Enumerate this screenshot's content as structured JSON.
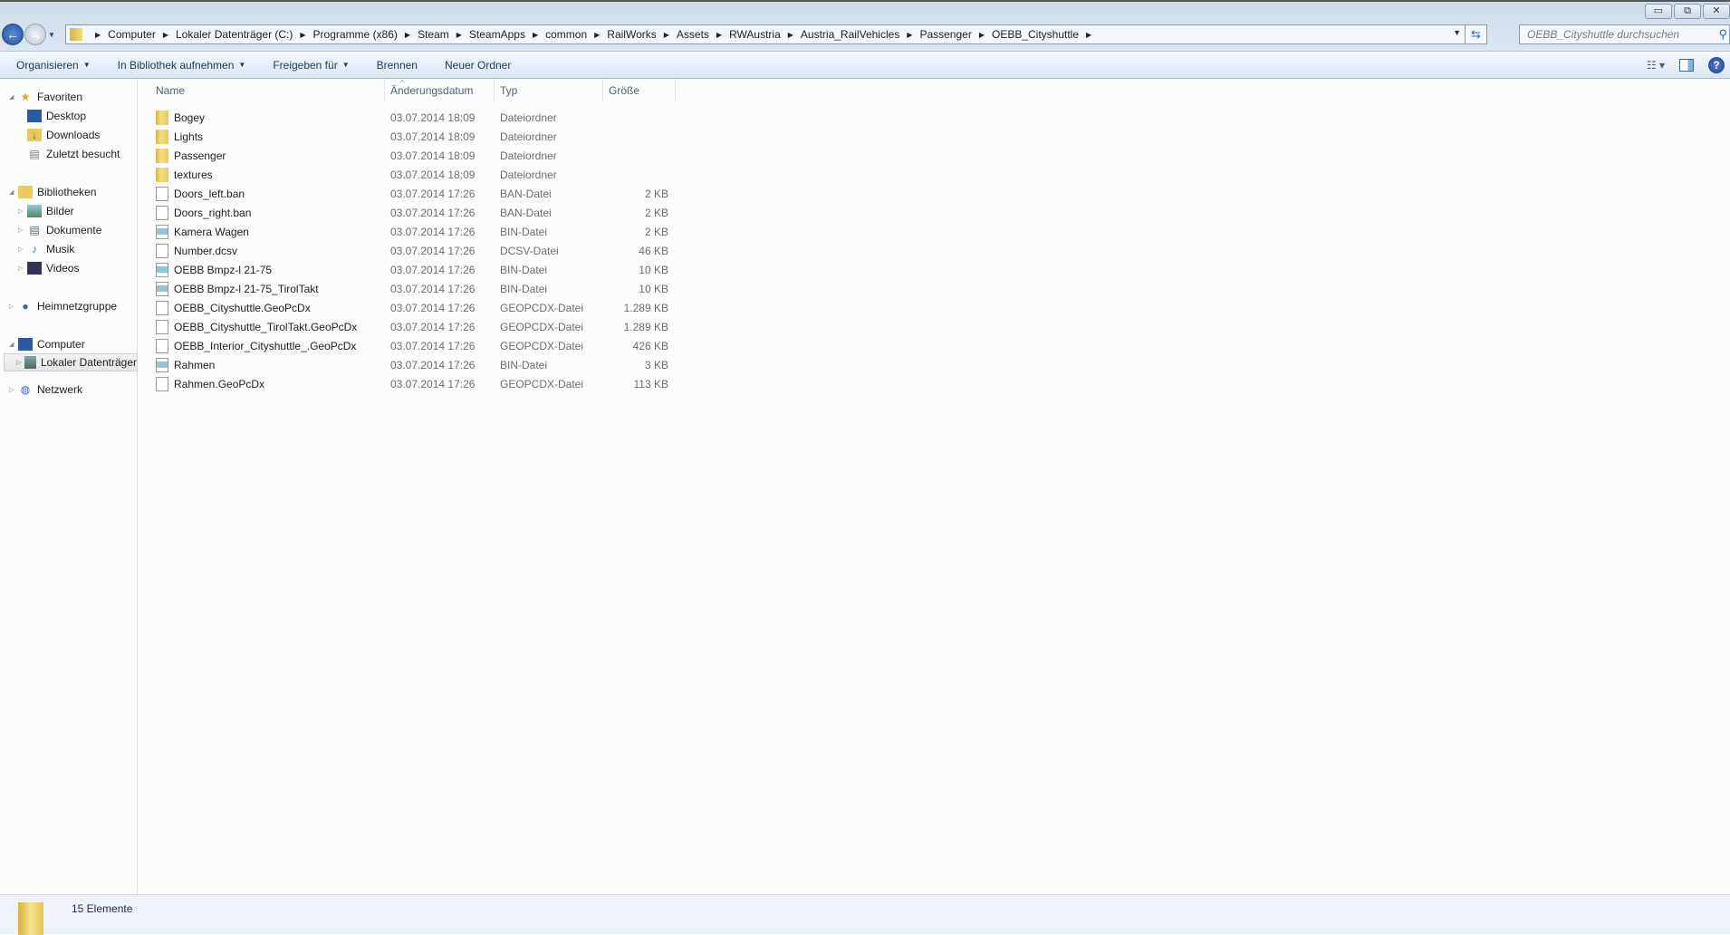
{
  "window": {
    "minimize": "▭",
    "restore": "⧉",
    "close": "✕"
  },
  "address": {
    "crumbs": [
      "Computer",
      "Lokaler Datenträger (C:)",
      "Programme (x86)",
      "Steam",
      "SteamApps",
      "common",
      "RailWorks",
      "Assets",
      "RWAustria",
      "Austria_RailVehicles",
      "Passenger",
      "OEBB_Cityshuttle"
    ]
  },
  "search": {
    "placeholder": "OEBB_Cityshuttle durchsuchen"
  },
  "toolbar": {
    "organize": "Organisieren",
    "library": "In Bibliothek aufnehmen",
    "share": "Freigeben für",
    "burn": "Brennen",
    "new_folder": "Neuer Ordner"
  },
  "sidebar": {
    "favorites": "Favoriten",
    "desktop": "Desktop",
    "downloads": "Downloads",
    "recent": "Zuletzt besucht",
    "libraries": "Bibliotheken",
    "pictures": "Bilder",
    "documents": "Dokumente",
    "music": "Musik",
    "videos": "Videos",
    "homegroup": "Heimnetzgruppe",
    "computer": "Computer",
    "local_disk": "Lokaler Datenträger",
    "network": "Netzwerk"
  },
  "columns": {
    "name": "Name",
    "date": "Änderungsdatum",
    "type": "Typ",
    "size": "Größe"
  },
  "files": [
    {
      "name": "Bogey",
      "date": "03.07.2014 18:09",
      "type": "Dateiordner",
      "size": "",
      "icon": "folder"
    },
    {
      "name": "Lights",
      "date": "03.07.2014 18:09",
      "type": "Dateiordner",
      "size": "",
      "icon": "folder"
    },
    {
      "name": "Passenger",
      "date": "03.07.2014 18:09",
      "type": "Dateiordner",
      "size": "",
      "icon": "folder"
    },
    {
      "name": "textures",
      "date": "03.07.2014 18:09",
      "type": "Dateiordner",
      "size": "",
      "icon": "folder"
    },
    {
      "name": "Doors_left.ban",
      "date": "03.07.2014 17:26",
      "type": "BAN-Datei",
      "size": "2 KB",
      "icon": "file"
    },
    {
      "name": "Doors_right.ban",
      "date": "03.07.2014 17:26",
      "type": "BAN-Datei",
      "size": "2 KB",
      "icon": "file"
    },
    {
      "name": "Kamera Wagen",
      "date": "03.07.2014 17:26",
      "type": "BIN-Datei",
      "size": "2 KB",
      "icon": "bin"
    },
    {
      "name": "Number.dcsv",
      "date": "03.07.2014 17:26",
      "type": "DCSV-Datei",
      "size": "46 KB",
      "icon": "file"
    },
    {
      "name": "OEBB Bmpz-l 21-75",
      "date": "03.07.2014 17:26",
      "type": "BIN-Datei",
      "size": "10 KB",
      "icon": "bin"
    },
    {
      "name": "OEBB Bmpz-l 21-75_TirolTakt",
      "date": "03.07.2014 17:26",
      "type": "BIN-Datei",
      "size": "10 KB",
      "icon": "bin"
    },
    {
      "name": "OEBB_Cityshuttle.GeoPcDx",
      "date": "03.07.2014 17:26",
      "type": "GEOPCDX-Datei",
      "size": "1.289 KB",
      "icon": "file"
    },
    {
      "name": "OEBB_Cityshuttle_TirolTakt.GeoPcDx",
      "date": "03.07.2014 17:26",
      "type": "GEOPCDX-Datei",
      "size": "1.289 KB",
      "icon": "file"
    },
    {
      "name": "OEBB_Interior_Cityshuttle_.GeoPcDx",
      "date": "03.07.2014 17:26",
      "type": "GEOPCDX-Datei",
      "size": "426 KB",
      "icon": "file"
    },
    {
      "name": "Rahmen",
      "date": "03.07.2014 17:26",
      "type": "BIN-Datei",
      "size": "3 KB",
      "icon": "bin"
    },
    {
      "name": "Rahmen.GeoPcDx",
      "date": "03.07.2014 17:26",
      "type": "GEOPCDX-Datei",
      "size": "113 KB",
      "icon": "file"
    }
  ],
  "status": {
    "count": "15 Elemente"
  }
}
